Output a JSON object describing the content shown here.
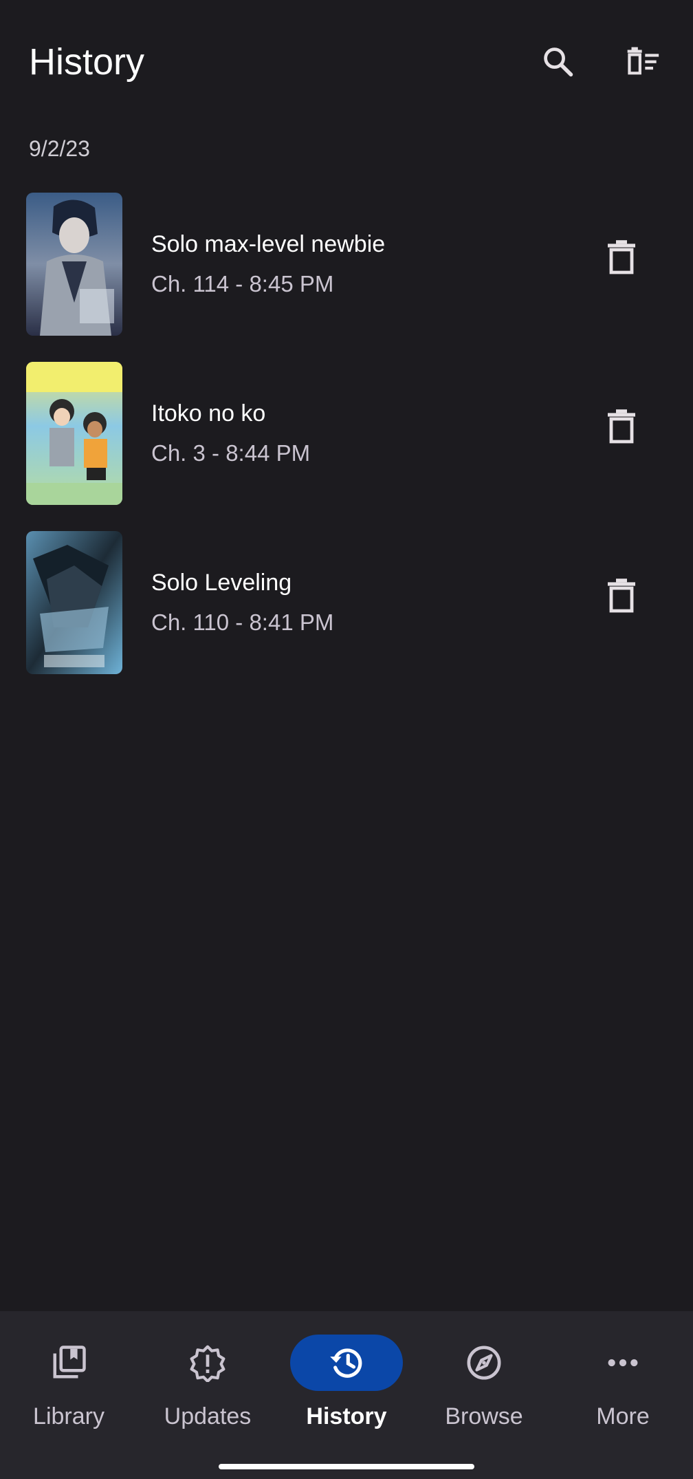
{
  "header": {
    "title": "History",
    "search_icon": "search-icon",
    "clear_icon": "delete-sweep-icon"
  },
  "date_group": "9/2/23",
  "items": [
    {
      "title": "Solo max-level newbie",
      "subtitle": "Ch. 114 - 8:45 PM",
      "delete_icon": "trash-icon"
    },
    {
      "title": "Itoko no ko",
      "subtitle": "Ch. 3 - 8:44 PM",
      "delete_icon": "trash-icon"
    },
    {
      "title": "Solo Leveling",
      "subtitle": "Ch. 110 - 8:41 PM",
      "delete_icon": "trash-icon"
    }
  ],
  "nav": {
    "items": [
      {
        "label": "Library",
        "icon": "library-icon"
      },
      {
        "label": "Updates",
        "icon": "updates-icon"
      },
      {
        "label": "History",
        "icon": "history-icon",
        "active": true
      },
      {
        "label": "Browse",
        "icon": "compass-icon"
      },
      {
        "label": "More",
        "icon": "more-icon"
      }
    ]
  },
  "colors": {
    "background": "#1c1b1f",
    "nav_background": "#27262c",
    "active_pill": "#0b47a8",
    "text_primary": "#ffffff",
    "text_secondary": "#cac4d0"
  }
}
